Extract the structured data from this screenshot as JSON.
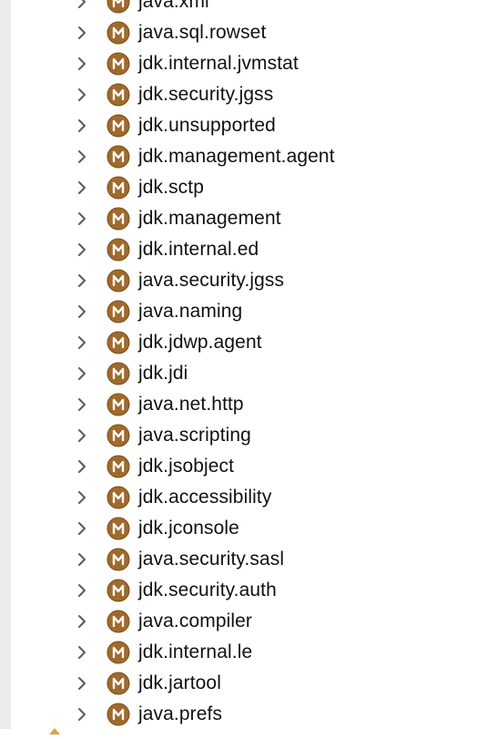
{
  "tree": {
    "items": [
      {
        "label": "java.xml",
        "icon": "module-icon"
      },
      {
        "label": "java.sql.rowset",
        "icon": "module-icon"
      },
      {
        "label": "jdk.internal.jvmstat",
        "icon": "module-icon"
      },
      {
        "label": "jdk.security.jgss",
        "icon": "module-icon"
      },
      {
        "label": "jdk.unsupported",
        "icon": "module-icon"
      },
      {
        "label": "jdk.management.agent",
        "icon": "module-icon"
      },
      {
        "label": "jdk.sctp",
        "icon": "module-icon"
      },
      {
        "label": "jdk.management",
        "icon": "module-icon"
      },
      {
        "label": "jdk.internal.ed",
        "icon": "module-icon"
      },
      {
        "label": "java.security.jgss",
        "icon": "module-icon"
      },
      {
        "label": "java.naming",
        "icon": "module-icon"
      },
      {
        "label": "jdk.jdwp.agent",
        "icon": "module-icon"
      },
      {
        "label": "jdk.jdi",
        "icon": "module-icon"
      },
      {
        "label": "java.net.http",
        "icon": "module-icon"
      },
      {
        "label": "java.scripting",
        "icon": "module-icon"
      },
      {
        "label": "jdk.jsobject",
        "icon": "module-icon"
      },
      {
        "label": "jdk.accessibility",
        "icon": "module-icon"
      },
      {
        "label": "jdk.jconsole",
        "icon": "module-icon"
      },
      {
        "label": "java.security.sasl",
        "icon": "module-icon"
      },
      {
        "label": "jdk.security.auth",
        "icon": "module-icon"
      },
      {
        "label": "java.compiler",
        "icon": "module-icon"
      },
      {
        "label": "jdk.internal.le",
        "icon": "module-icon"
      },
      {
        "label": "jdk.jartool",
        "icon": "module-icon"
      },
      {
        "label": "java.prefs",
        "icon": "module-icon"
      }
    ]
  },
  "colors": {
    "module_icon_fill": "#a06a2c",
    "module_icon_letter": "#ffffff",
    "chevron": "#5a5a5a",
    "label_text": "#111111",
    "gutter": "#ececec"
  },
  "module_icon_letter": "M"
}
